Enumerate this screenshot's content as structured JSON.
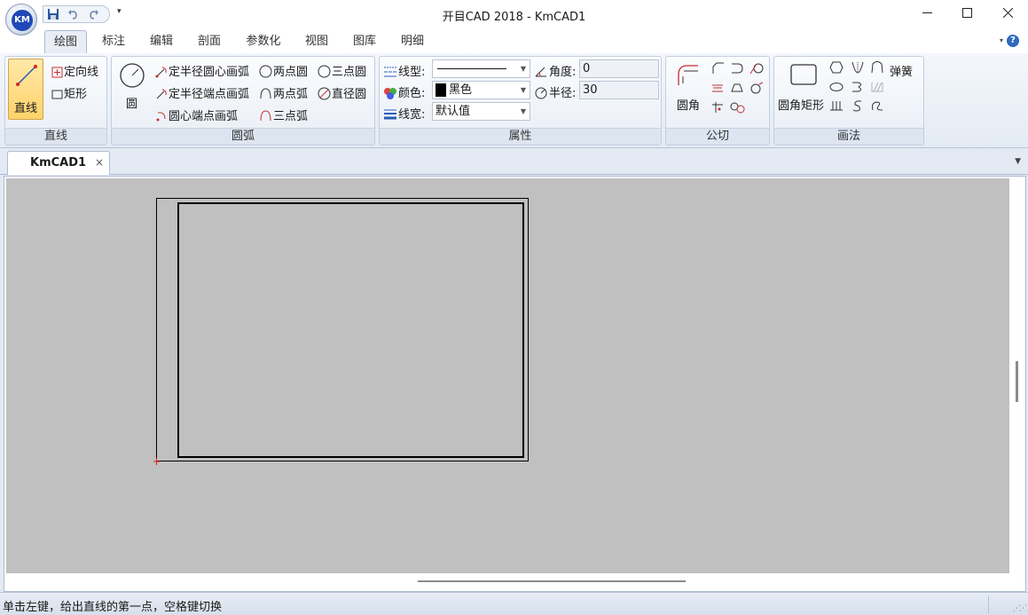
{
  "window": {
    "title": "开目CAD 2018 - KmCAD1",
    "app_logo": "KM"
  },
  "quick_access": {
    "icons": [
      "save-icon",
      "undo-icon",
      "redo-icon",
      "customize-icon"
    ],
    "more": "▾"
  },
  "ribbon": {
    "tabs": [
      "绘图",
      "标注",
      "编辑",
      "剖面",
      "参数化",
      "视图",
      "图库",
      "明细"
    ],
    "active_tab": "绘图",
    "groups": {
      "line": {
        "label": "直线",
        "line_label": "直线",
        "oriented_line_label": "定向线",
        "rectangle_label": "矩形"
      },
      "arc": {
        "label": "圆弧",
        "circle_label": "圆",
        "fixed_radius_center_arc": "定半径圆心画弧",
        "two_point_circle": "两点圆",
        "three_point_circle": "三点圆",
        "fixed_radius_endpoint_arc": "定半径端点画弧",
        "two_point_arc": "两点弧",
        "diameter_circle": "直径圆",
        "center_endpoint_arc": "圆心端点画弧",
        "three_point_arc": "三点弧"
      },
      "properties": {
        "label": "属性",
        "linetype_label": "线型:",
        "color_label": "颜色:",
        "color_value": "黑色",
        "color_swatch": "#000000",
        "linewidth_label": "线宽:",
        "linewidth_value": "默认值",
        "angle_label": "角度:",
        "angle_value": "0",
        "radius_label": "半径:",
        "radius_value": "30"
      },
      "tangent": {
        "label": "公切",
        "fillet_label": "圆角"
      },
      "drawing_methods": {
        "label": "画法",
        "rounded_rect_label": "圆角矩形",
        "spring_label": "弹簧"
      }
    },
    "help": "?"
  },
  "document_tabs": [
    {
      "label": "KmCAD1",
      "close": "×",
      "active": true
    }
  ],
  "status": {
    "message": "单击左键，给出直线的第一点，空格键切换"
  },
  "colors": {
    "canvas_bg": "#c0c0c0",
    "active_button": "#ffd26a",
    "cursor_red": "#e02020"
  }
}
